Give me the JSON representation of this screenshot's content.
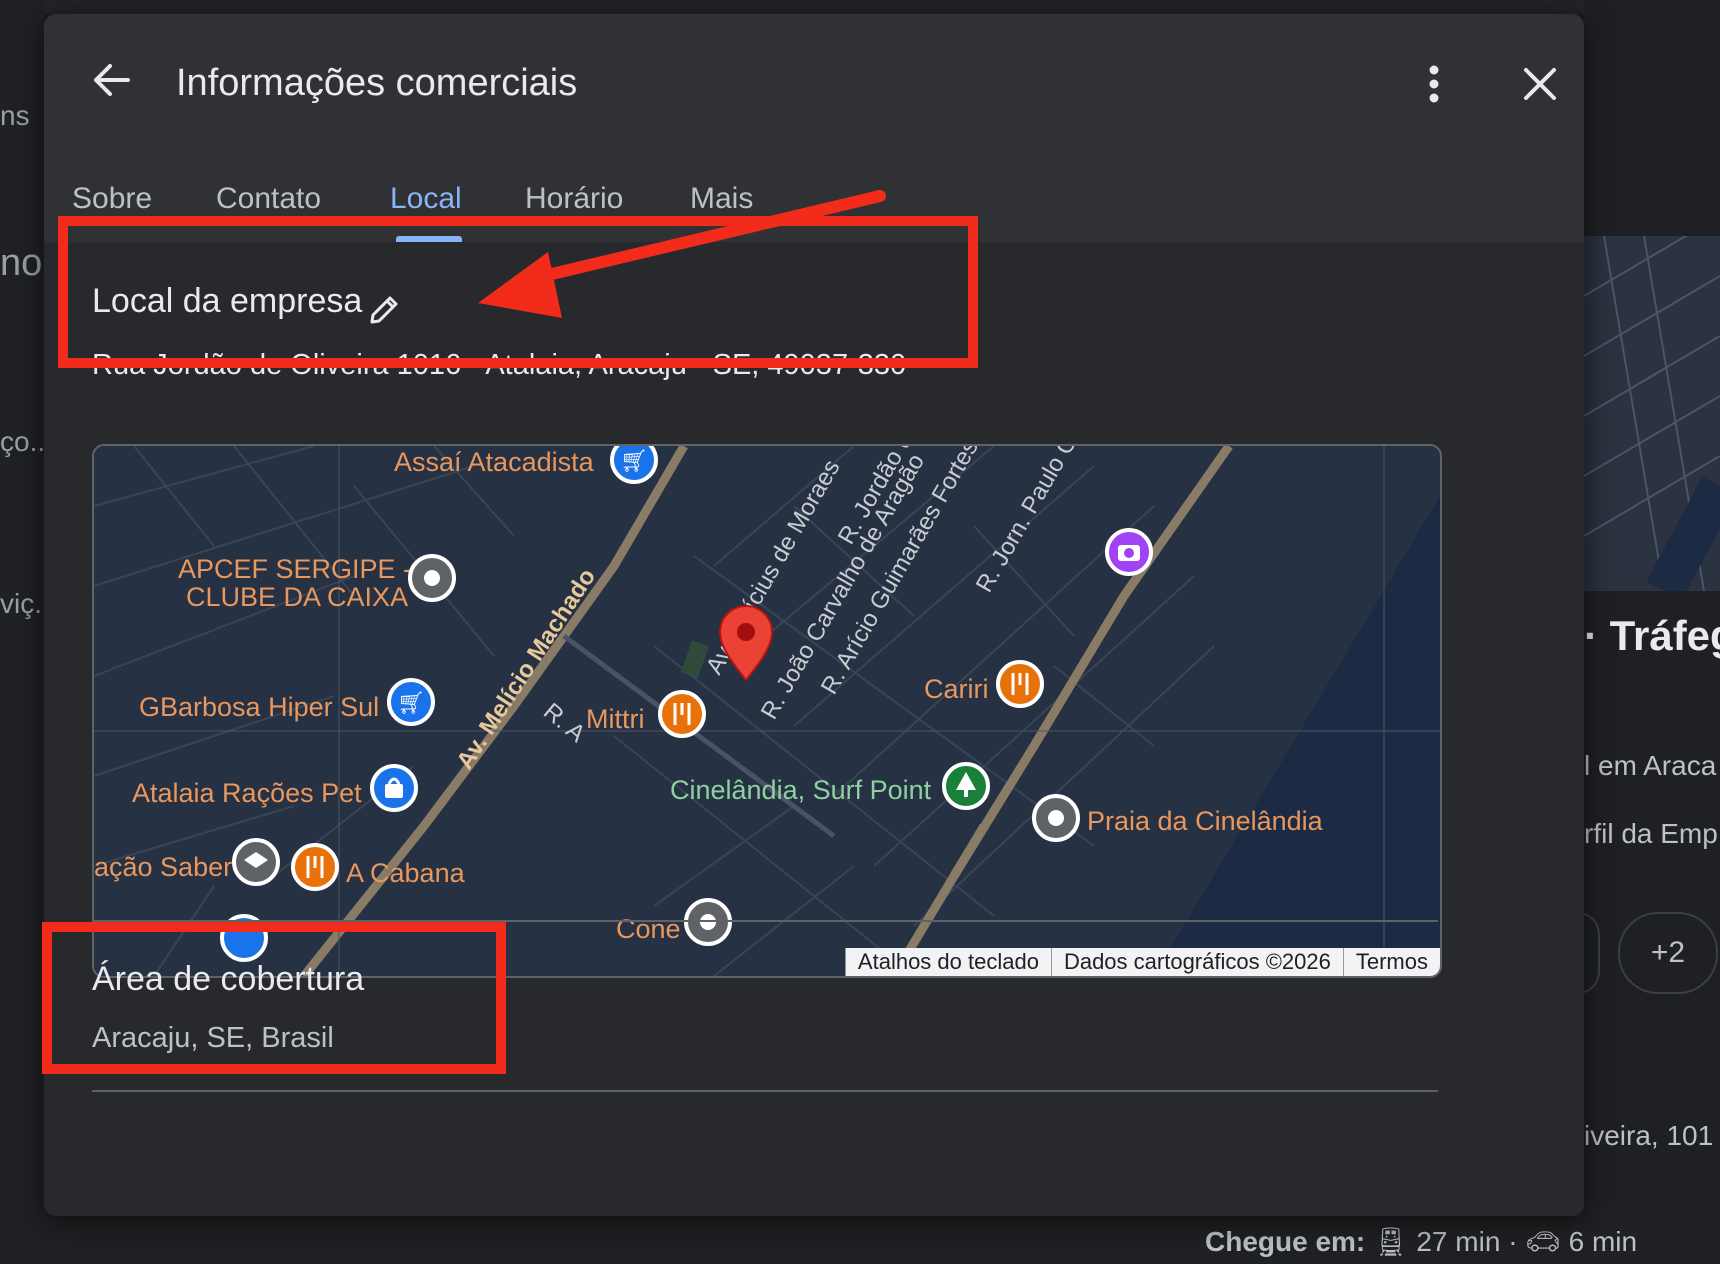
{
  "background": {
    "left_fragments": [
      "ns",
      "no",
      "ço..",
      "viç."
    ],
    "right_heading": "· Tráfeg",
    "right_lines": [
      "l em Araca",
      "rfil da Emp",
      "iveira, 101"
    ],
    "chip_label": "+2",
    "travel_label": "Chegue em:",
    "transit_time": "27 min",
    "drive_time": "6 min",
    "dot_separator": "·"
  },
  "dialog": {
    "title": "Informações comerciais",
    "tabs": [
      {
        "label": "Sobre"
      },
      {
        "label": "Contato"
      },
      {
        "label": "Local"
      },
      {
        "label": "Horário"
      },
      {
        "label": "Mais"
      }
    ],
    "active_tab": "Local"
  },
  "location": {
    "heading": "Local da empresa",
    "address": "Rua Jordão de Oliveira 1016 - Atalaia, Aracaju - SE, 49037-330"
  },
  "map": {
    "places": [
      {
        "name": "Assaí Atacadista",
        "icon": "cart-icon"
      },
      {
        "name": "APCEF SERGIPE -",
        "icon": "pin-icon"
      },
      {
        "name": "CLUBE DA CAIXA",
        "icon": ""
      },
      {
        "name": "GBarbosa Hiper Sul",
        "icon": "cart-icon"
      },
      {
        "name": "Atalaia Rações Pet",
        "icon": "shopping-bag-icon"
      },
      {
        "name": "ação Saber",
        "icon": "school-icon"
      },
      {
        "name": "A Cabana",
        "icon": "restaurant-icon"
      },
      {
        "name": "Mittri",
        "icon": "restaurant-icon"
      },
      {
        "name": "Cariri",
        "icon": "restaurant-icon"
      },
      {
        "name": "Cinelândia, Surf Point",
        "icon": "tree-icon"
      },
      {
        "name": "Praia da Cinelândia",
        "icon": "pin-icon"
      },
      {
        "name": "Cone",
        "icon": "pin-icon"
      }
    ],
    "streets": [
      "Av. Melício Machado",
      "Av. Vinícius de Moraes",
      "R. Jordão de",
      "R. João Carvalho de Aragão",
      "R. Arício Guimarães Fortes",
      "R. Jorn. Paulo Cos",
      "R. A"
    ],
    "footer": [
      "Atalhos do teclado",
      "Dados cartográficos ©2026",
      "Termos"
    ],
    "colors": {
      "water": "#1c2a44",
      "land": "#263143",
      "road": "#8a7b66",
      "label": "#e8975d",
      "park_label": "#8fd0a0"
    }
  },
  "coverage": {
    "heading": "Área de cobertura",
    "value": "Aracaju, SE, Brasil"
  },
  "annotations": {
    "highlight_color": "#f22b1b"
  }
}
